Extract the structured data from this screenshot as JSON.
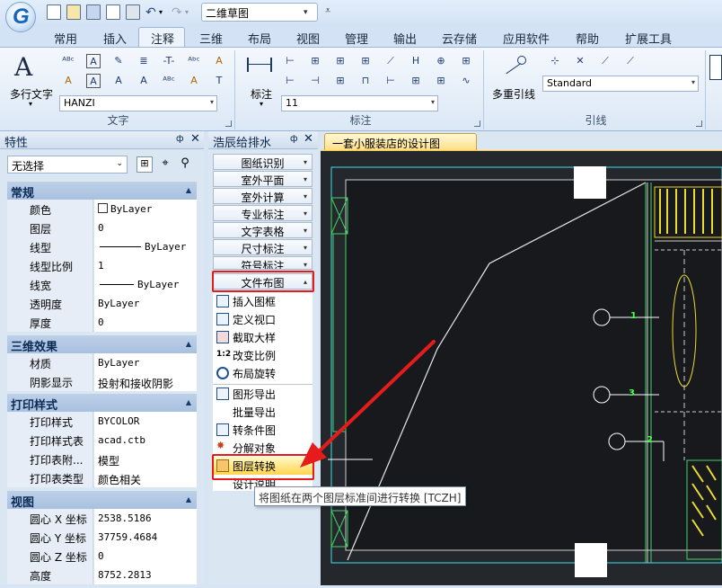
{
  "app": {
    "doc_title": "二维草图"
  },
  "tabs": [
    "常用",
    "插入",
    "注释",
    "三维",
    "布局",
    "视图",
    "管理",
    "输出",
    "云存储",
    "应用软件",
    "帮助",
    "扩展工具"
  ],
  "active_tab": "注释",
  "ribbon": {
    "text_group": {
      "label": "文字",
      "big_button": "多行文字",
      "style_combo": "HANZI"
    },
    "dim_group": {
      "label": "标注",
      "big_button": "标注",
      "style_combo": "11"
    },
    "leader_group": {
      "label": "引线",
      "big_button": "多重引线",
      "style_combo": "Standard"
    }
  },
  "properties": {
    "title": "特性",
    "selection": "无选择",
    "sections": [
      {
        "name": "常规",
        "rows": [
          [
            "颜色",
            "ByLayer"
          ],
          [
            "图层",
            "0"
          ],
          [
            "线型",
            "ByLayer"
          ],
          [
            "线型比例",
            "1"
          ],
          [
            "线宽",
            "ByLayer"
          ],
          [
            "透明度",
            "ByLayer"
          ],
          [
            "厚度",
            "0"
          ]
        ]
      },
      {
        "name": "三维效果",
        "rows": [
          [
            "材质",
            "ByLayer"
          ],
          [
            "阴影显示",
            "投射和接收阴影"
          ]
        ]
      },
      {
        "name": "打印样式",
        "rows": [
          [
            "打印样式",
            "BYCOLOR"
          ],
          [
            "打印样式表",
            "acad.ctb"
          ],
          [
            "打印表附...",
            "模型"
          ],
          [
            "打印表类型",
            "颜色相关"
          ]
        ]
      },
      {
        "name": "视图",
        "rows": [
          [
            "圆心 X 坐标",
            "2538.5186"
          ],
          [
            "圆心 Y 坐标",
            "37759.4684"
          ],
          [
            "圆心 Z 坐标",
            "0"
          ],
          [
            "高度",
            "8752.2813"
          ]
        ]
      }
    ]
  },
  "plugin": {
    "title": "浩辰给排水",
    "menus": [
      "图纸识别",
      "室外平面",
      "室外计算",
      "专业标注",
      "文字表格",
      "尺寸标注",
      "符号标注",
      "文件布图"
    ],
    "items": [
      "插入图框",
      "定义视口",
      "截取大样",
      "改变比例",
      "布局旋转",
      "图形导出",
      "批量导出",
      "转条件图",
      "分解对象",
      "图层转换",
      "设计说明"
    ],
    "tooltip": "将图纸在两个图层标准间进行转换 [TCZH]"
  },
  "drawing": {
    "tab": "一套小服装店的设计图",
    "labels": [
      "1",
      "3",
      "2"
    ]
  }
}
